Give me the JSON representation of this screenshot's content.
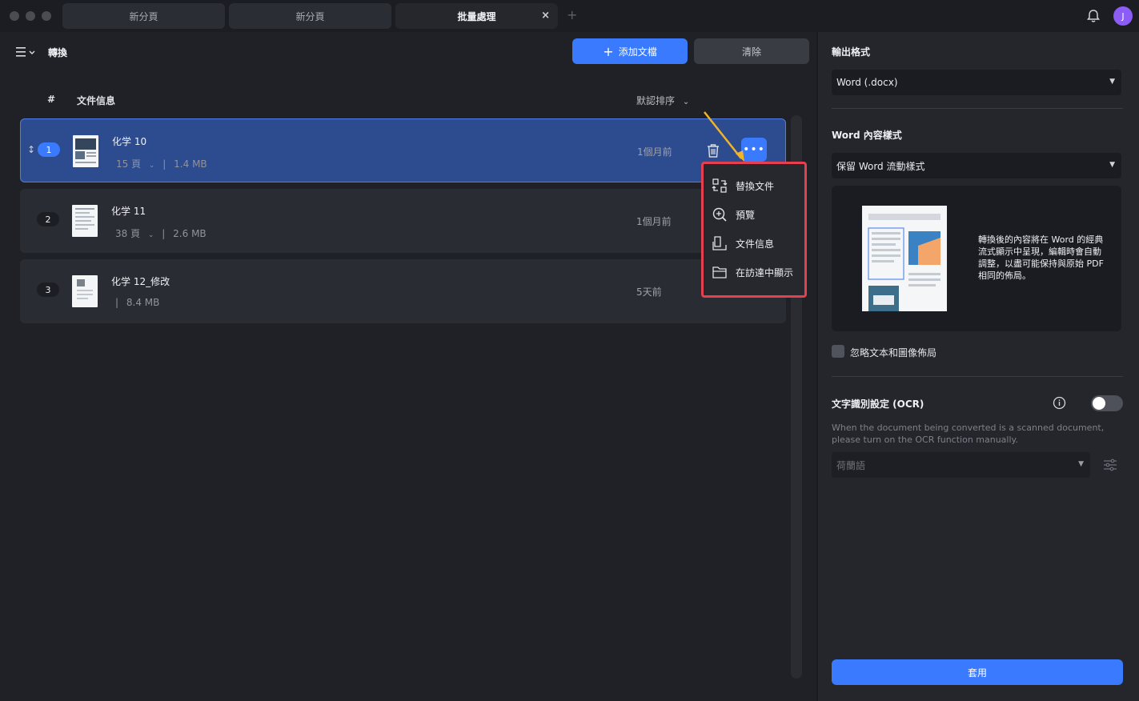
{
  "titlebar": {
    "tabs": [
      {
        "label": "新分頁"
      },
      {
        "label": "新分頁"
      },
      {
        "label": "批量處理"
      }
    ],
    "close_symbol": "×",
    "plus_symbol": "+",
    "avatar_initial": "J"
  },
  "toolbar": {
    "title": "轉換",
    "add_label": "添加文檔",
    "clear_label": "清除"
  },
  "list": {
    "col_hash": "#",
    "col_info": "文件信息",
    "sort_label": "默認排序",
    "rows": [
      {
        "index": "1",
        "name": "化学 10",
        "pages": "15 頁",
        "size": "1.4 MB",
        "date": "1個月前",
        "selected": true
      },
      {
        "index": "2",
        "name": "化学 11",
        "pages": "38 頁",
        "size": "2.6 MB",
        "date": "1個月前",
        "selected": false
      },
      {
        "index": "3",
        "name": "化学 12_修改",
        "pages": "",
        "size": "8.4 MB",
        "date": "5天前",
        "selected": false
      }
    ]
  },
  "context_menu": {
    "items": [
      {
        "label": "替換文件",
        "icon": "replace-icon"
      },
      {
        "label": "預覽",
        "icon": "zoom-icon"
      },
      {
        "label": "文件信息",
        "icon": "file-info-icon"
      },
      {
        "label": "在訪達中顯示",
        "icon": "folder-icon"
      }
    ]
  },
  "side": {
    "output_label": "輸出格式",
    "output_value": "Word (.docx)",
    "style_label": "Word 內容樣式",
    "style_value": "保留 Word 流動樣式",
    "preview_text": "轉換後的內容將在 Word 的經典流式顯示中呈現，編輯時會自動調整，以盡可能保持與原始 PDF 相同的佈局。",
    "ignore_label": "忽略文本和圖像佈局",
    "ocr_label": "文字識別設定 (OCR)",
    "ocr_desc": "When the document being converted is a scanned document, please turn on the OCR function manually.",
    "ocr_lang": "荷蘭語",
    "ocr_enabled": false,
    "apply_label": "套用"
  },
  "colors": {
    "accent": "#3a7afe",
    "highlight": "#e5404f",
    "arrow": "#f0b429"
  }
}
